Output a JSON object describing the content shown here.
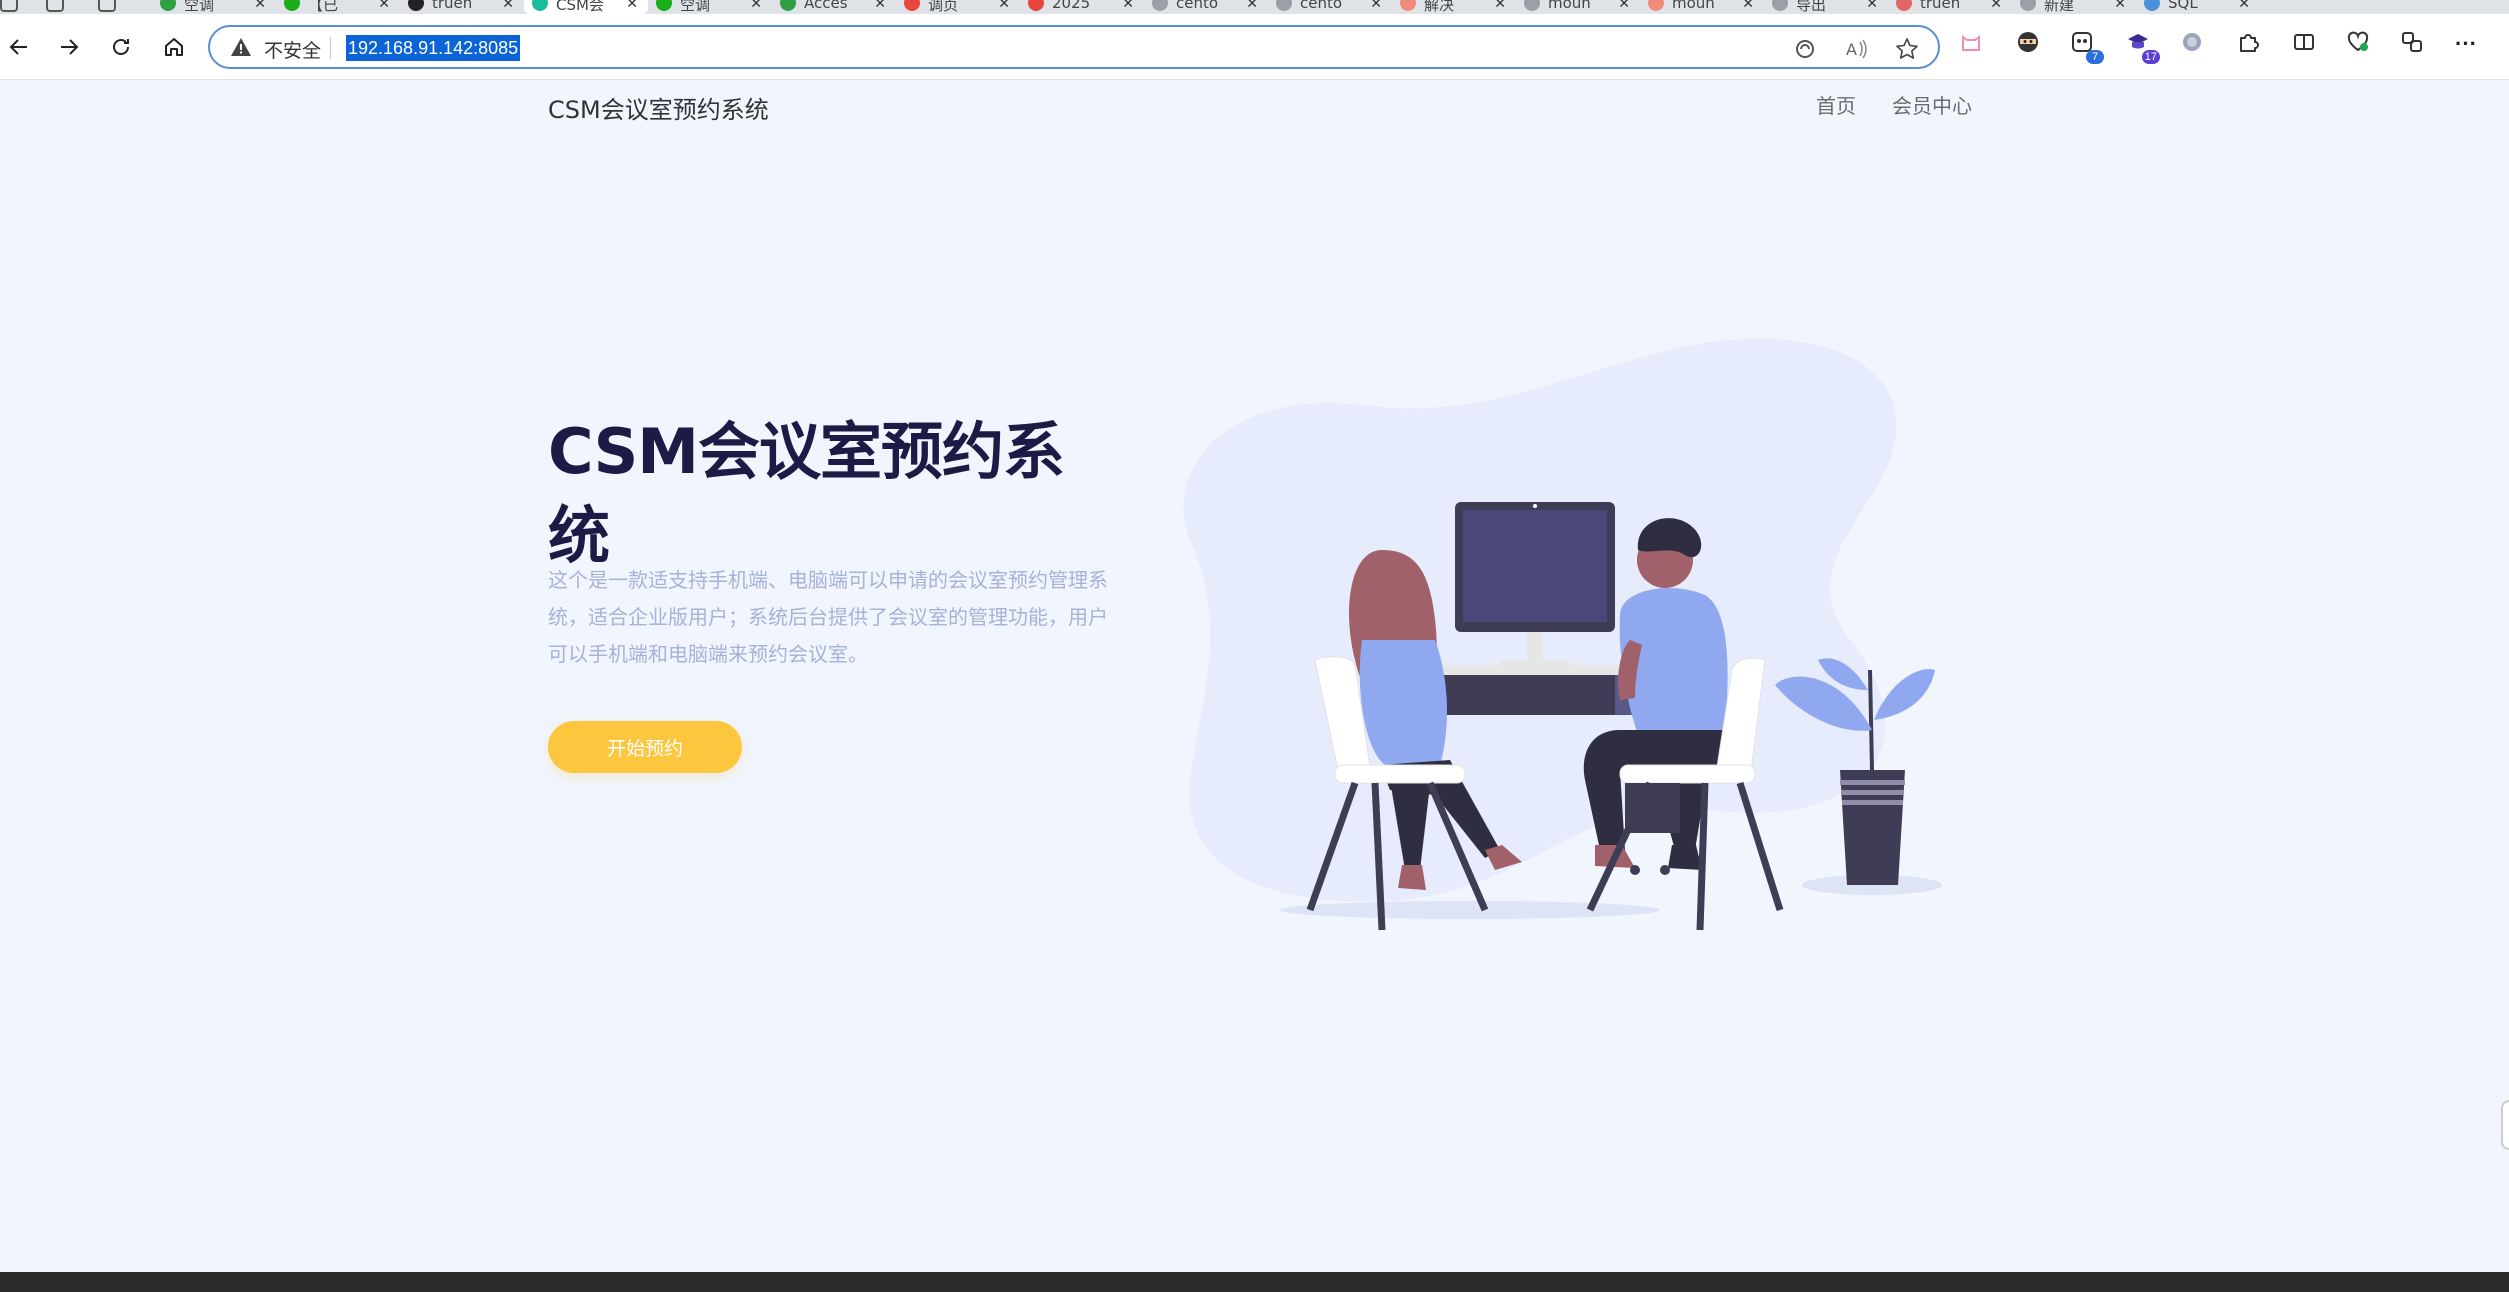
{
  "browser": {
    "tabs": [
      {
        "label": "空调",
        "color": "#2ea043"
      },
      {
        "label": "【已",
        "color": "#1aad19"
      },
      {
        "label": "truen",
        "color": "#222222"
      },
      {
        "label": "CSM会",
        "color": "#1abc9c"
      },
      {
        "label": "空调",
        "color": "#1aad19"
      },
      {
        "label": "Acces",
        "color": "#2ea043"
      },
      {
        "label": "调页",
        "color": "#e8453c"
      },
      {
        "label": "2025",
        "color": "#e8453c"
      },
      {
        "label": "cento",
        "color": "#9aa0a6"
      },
      {
        "label": "cento",
        "color": "#9aa0a6"
      },
      {
        "label": "解决",
        "color": "#f08a7a"
      },
      {
        "label": "moun",
        "color": "#9aa0a6"
      },
      {
        "label": "moun",
        "color": "#f08a7a"
      },
      {
        "label": "导出",
        "color": "#9aa0a6"
      },
      {
        "label": "truen",
        "color": "#e06666"
      },
      {
        "label": "新建",
        "color": "#9aa0a6"
      },
      {
        "label": "SQL",
        "color": "#4a90d9"
      }
    ],
    "active_tab_index": 3,
    "tab_close": "✕",
    "address": {
      "security_label": "不安全",
      "url": "192.168.91.142:8085"
    },
    "extensions": [
      {
        "icon": "cat-icon",
        "badge": ""
      },
      {
        "icon": "ninja-icon",
        "badge": ""
      },
      {
        "icon": "panda-icon",
        "badge": "7"
      },
      {
        "icon": "graduation-cap-icon",
        "badge": "17"
      },
      {
        "icon": "circle-icon",
        "badge": ""
      },
      {
        "icon": "puzzle-icon",
        "badge": ""
      },
      {
        "icon": "split-screen-icon",
        "badge": ""
      },
      {
        "icon": "heart-health-icon",
        "badge": ""
      },
      {
        "icon": "collections-icon",
        "badge": ""
      },
      {
        "icon": "more-icon",
        "badge": ""
      }
    ],
    "more_glyph": "···"
  },
  "site": {
    "brand": "CSM会议室预约系统",
    "nav": {
      "home": "首页",
      "member_center": "会员中心"
    },
    "hero": {
      "title": "CSM会议室预约系统",
      "description": "这个是一款适支持手机端、电脑端可以申请的会议室预约管理系统，适合企业版用户；系统后台提供了会议室的管理功能，用户可以手机端和电脑端来预约会议室。",
      "cta": "开始预约"
    }
  },
  "colors": {
    "accent": "#fcc63f",
    "title": "#1b1b46",
    "desc": "#a7b2d8",
    "illustration_primary": "#8fa8f0",
    "background": "#f1f5fd"
  }
}
